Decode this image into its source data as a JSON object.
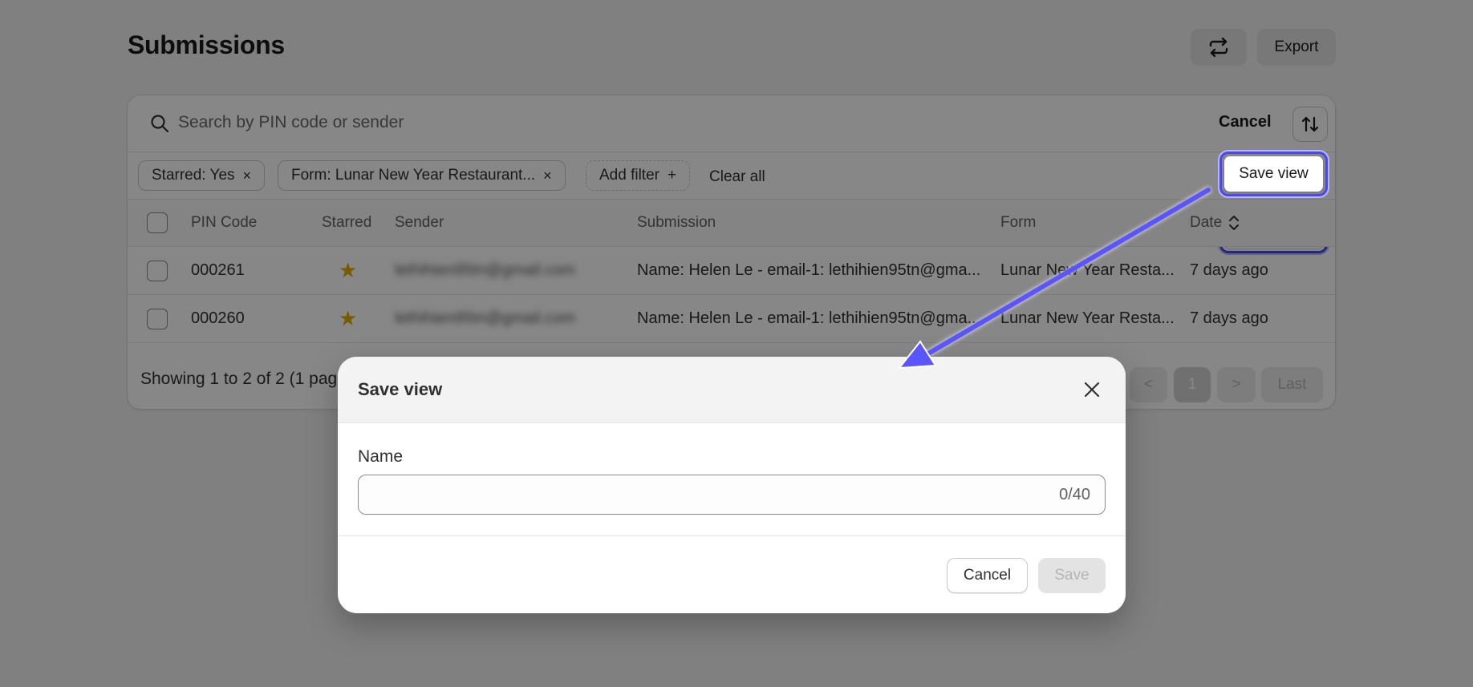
{
  "page": {
    "title": "Submissions"
  },
  "header": {
    "export_label": "Export",
    "sync_icon": "sync-icon"
  },
  "search": {
    "placeholder": "Search by PIN code or sender",
    "cancel_label": "Cancel",
    "sort_icon": "sort-icon"
  },
  "filters": {
    "chips": [
      {
        "label": "Starred: Yes",
        "remove": "×"
      },
      {
        "label": "Form: Lunar New Year Restaurant...",
        "remove": "×"
      }
    ],
    "add_filter_label": "Add filter",
    "add_filter_icon": "+",
    "clear_all_label": "Clear all",
    "save_view_label": "Save view"
  },
  "table": {
    "columns": [
      "PIN Code",
      "Starred",
      "Sender",
      "Submission",
      "Form",
      "Date"
    ],
    "rows": [
      {
        "pin": "000261",
        "starred": "★",
        "sender": "lethihien95tn@gmail.com",
        "submission": "Name: Helen Le - email-1: lethihien95tn@gma...",
        "form": "Lunar New Year Resta...",
        "date": "7 days ago"
      },
      {
        "pin": "000260",
        "starred": "★",
        "sender": "lethihien95tn@gmail.com",
        "submission": "Name: Helen Le - email-1: lethihien95tn@gma...",
        "form": "Lunar New Year Resta...",
        "date": "7 days ago"
      }
    ]
  },
  "pagination": {
    "summary": "Showing 1 to 2 of 2 (1 pag",
    "prev": "<",
    "current": "1",
    "next": ">",
    "last": "Last"
  },
  "modal": {
    "title": "Save view",
    "name_label": "Name",
    "counter": "0/40",
    "cancel_label": "Cancel",
    "save_label": "Save"
  },
  "colors": {
    "accent": "#4b47f5",
    "star": "#f5b800"
  }
}
